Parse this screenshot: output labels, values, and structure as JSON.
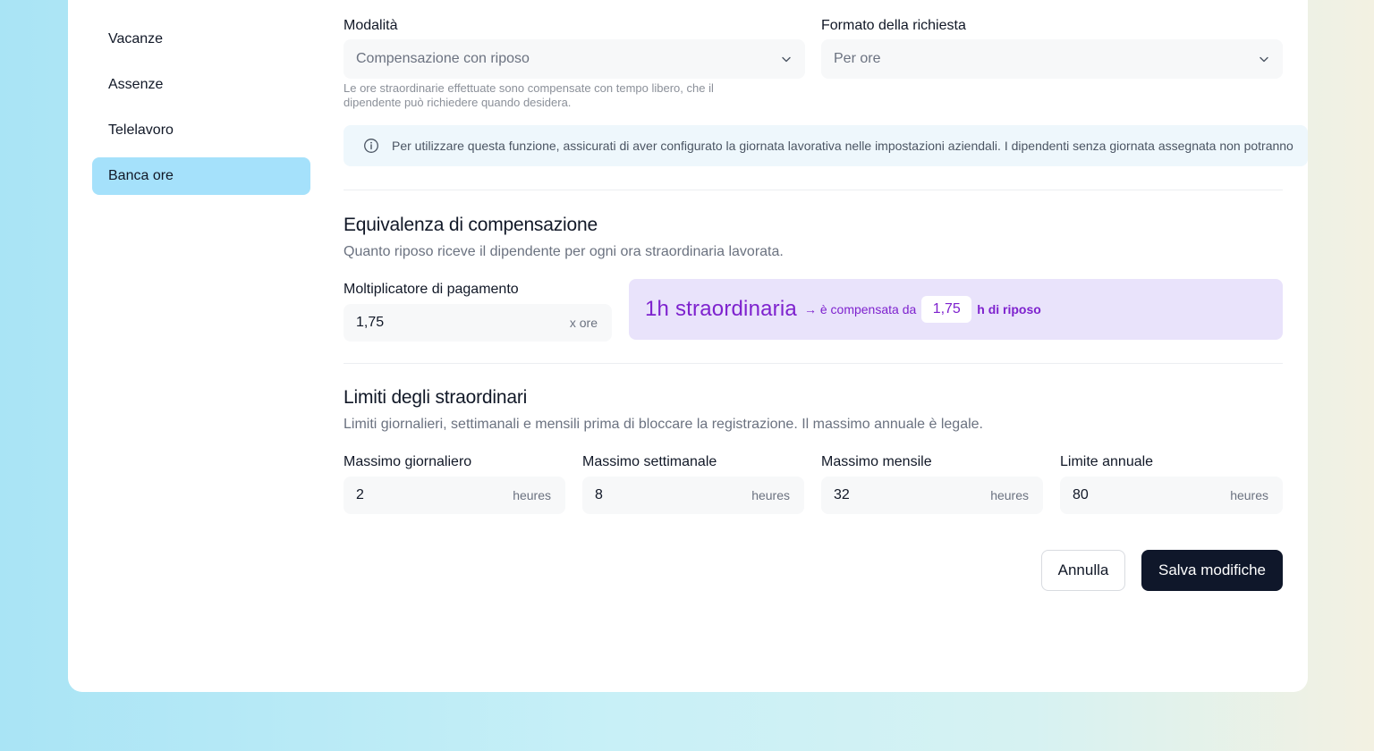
{
  "sidebar": {
    "items": [
      {
        "label": "Vacanze"
      },
      {
        "label": "Assenze"
      },
      {
        "label": "Telelavoro"
      },
      {
        "label": "Banca ore"
      }
    ]
  },
  "mode": {
    "label": "Modalità",
    "value": "Compensazione con riposo",
    "helper_line1": "Le ore straordinarie effettuate sono compensate con tempo libero, che il",
    "helper_line2": "dipendente può richiedere quando desidera."
  },
  "format": {
    "label": "Formato della richiesta",
    "value": "Per ore"
  },
  "info": {
    "text": "Per utilizzare questa funzione, assicurati di aver configurato la giornata lavorativa nelle impostazioni aziendali. I dipendenti senza giornata assegnata non potranno"
  },
  "equivalence": {
    "title": "Equivalenza di compensazione",
    "description": "Quanto riposo riceve il dipendente per ogni ora straordinaria lavorata.",
    "multiplier_label": "Moltiplicatore di pagamento",
    "multiplier_value": "1,75",
    "multiplier_unit": "x ore",
    "preview_big": "1h straordinaria",
    "preview_mid": "→ è compensata da",
    "preview_value": "1,75",
    "preview_end": "h di riposo"
  },
  "limits": {
    "title": "Limiti degli straordinari",
    "description": "Limiti giornalieri, settimanali e mensili prima di bloccare la registrazione. Il massimo annuale è legale.",
    "fields": [
      {
        "label": "Massimo giornaliero",
        "value": "2",
        "unit": "heures"
      },
      {
        "label": "Massimo settimanale",
        "value": "8",
        "unit": "heures"
      },
      {
        "label": "Massimo mensile",
        "value": "32",
        "unit": "heures"
      },
      {
        "label": "Limite annuale",
        "value": "80",
        "unit": "heures"
      }
    ]
  },
  "actions": {
    "cancel": "Annulla",
    "save": "Salva modifiche"
  },
  "colors": {
    "active_nav": "#a5e1fb",
    "accent_purple": "#7e22ce",
    "primary_button": "#0f172a"
  }
}
